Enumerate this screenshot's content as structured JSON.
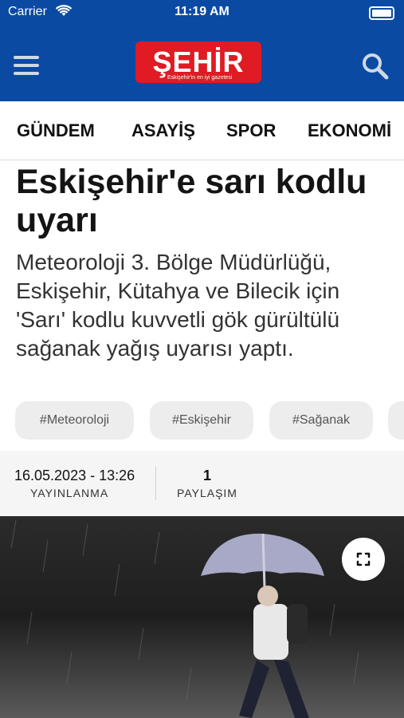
{
  "status_bar": {
    "carrier": "Carrier",
    "time": "11:19 AM"
  },
  "header": {
    "logo_text": "ŞEHİR",
    "logo_slogan": "Eskişehir'in en iyi gazetesi",
    "colors": {
      "bar": "#0a4aa3",
      "logo": "#e01b23"
    },
    "icons": {
      "menu": "hamburger-menu-icon",
      "search": "search-icon"
    }
  },
  "nav": {
    "tabs": [
      {
        "label": "GÜNDEM"
      },
      {
        "label": "ASAYİŞ"
      },
      {
        "label": "SPOR"
      },
      {
        "label": "EKONOMİ"
      }
    ]
  },
  "article": {
    "title": "Eskişehir'e sarı kodlu uyarı",
    "summary": "Meteoroloji 3. Bölge Müdürlüğü, Eskişehir, Kütahya ve Bilecik için 'Sarı' kodlu kuvvetli gök gürültülü sağanak yağış uyarısı yaptı.",
    "tags": [
      "#Meteoroloji",
      "#Eskişehir",
      "#Sağanak"
    ],
    "meta": {
      "date": "16.05.2023 - 13:26",
      "date_label": "YAYINLANMA",
      "share_count": "1",
      "share_label": "PAYLAŞIM"
    },
    "image": {
      "subject": "person walking with umbrella in rain",
      "expand_icon": "expand-icon"
    }
  }
}
